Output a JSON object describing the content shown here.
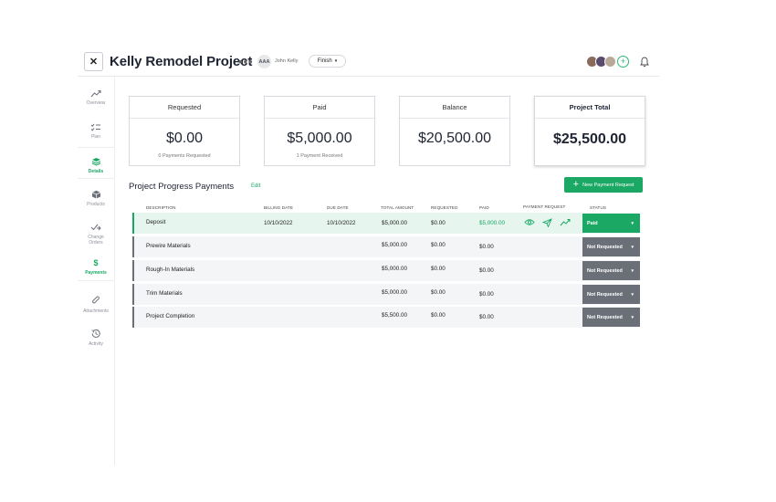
{
  "header": {
    "close_label": "✕",
    "title": "Kelly Remodel Project",
    "more_label": "•••",
    "owner_initials": "AAA",
    "owner_name": "John Kelly",
    "finish_label": "Finish",
    "add_label": "+"
  },
  "sidebar": {
    "items": [
      {
        "label": "Overview",
        "icon": "trend-icon"
      },
      {
        "label": "Plan",
        "icon": "checklist-icon"
      },
      {
        "label": "Details",
        "icon": "layers-icon",
        "active": true
      },
      {
        "label": "Products",
        "icon": "box-icon"
      },
      {
        "label": "Change Orders",
        "icon": "change-orders-icon"
      },
      {
        "label": "Payments",
        "icon": "dollar-icon",
        "active": true
      },
      {
        "label": "Attachments",
        "icon": "paperclip-icon"
      },
      {
        "label": "Activity",
        "icon": "history-icon"
      }
    ],
    "dollar_glyph": "$"
  },
  "summary": {
    "requested": {
      "label": "Requested",
      "value": "$0.00",
      "sub": "0 Payments Requested"
    },
    "paid": {
      "label": "Paid",
      "value": "$5,000.00",
      "sub": "1 Payment Received"
    },
    "balance": {
      "label": "Balance",
      "value": "$20,500.00"
    },
    "total": {
      "label": "Project Total",
      "value": "$25,500.00"
    }
  },
  "section": {
    "title": "Project Progress Payments",
    "edit_label": "Edit",
    "new_button_label": "New Payment Request",
    "new_button_plus": "+"
  },
  "table": {
    "columns": [
      "DESCRIPTION",
      "BILLING DATE",
      "DUE DATE",
      "TOTAL AMOUNT",
      "REQUESTED",
      "PAID",
      "PAYMENT REQUEST",
      "STATUS"
    ],
    "rows": [
      {
        "description": "Deposit",
        "billing_date": "10/10/2022",
        "due_date": "10/10/2022",
        "total": "$5,000.00",
        "requested": "$0.00",
        "paid": "$5,000.00",
        "status": "Paid"
      },
      {
        "description": "Prewire Materials",
        "billing_date": "",
        "due_date": "",
        "total": "$5,000.00",
        "requested": "$0.00",
        "paid": "$0.00",
        "status": "Not Requested"
      },
      {
        "description": "Rough-In Materials",
        "billing_date": "",
        "due_date": "",
        "total": "$5,000.00",
        "requested": "$0.00",
        "paid": "$0.00",
        "status": "Not Requested"
      },
      {
        "description": "Trim Materials",
        "billing_date": "",
        "due_date": "",
        "total": "$5,000.00",
        "requested": "$0.00",
        "paid": "$0.00",
        "status": "Not Requested"
      },
      {
        "description": "Project Completion",
        "billing_date": "",
        "due_date": "",
        "total": "$5,500.00",
        "requested": "$0.00",
        "paid": "$0.00",
        "status": "Not Requested"
      }
    ],
    "caret": "▾"
  },
  "colors": {
    "accent": "#1aa864",
    "status_gray": "#6b6f78",
    "paid_row_bg": "#e6f6ee",
    "row_bg": "#f4f5f7"
  }
}
